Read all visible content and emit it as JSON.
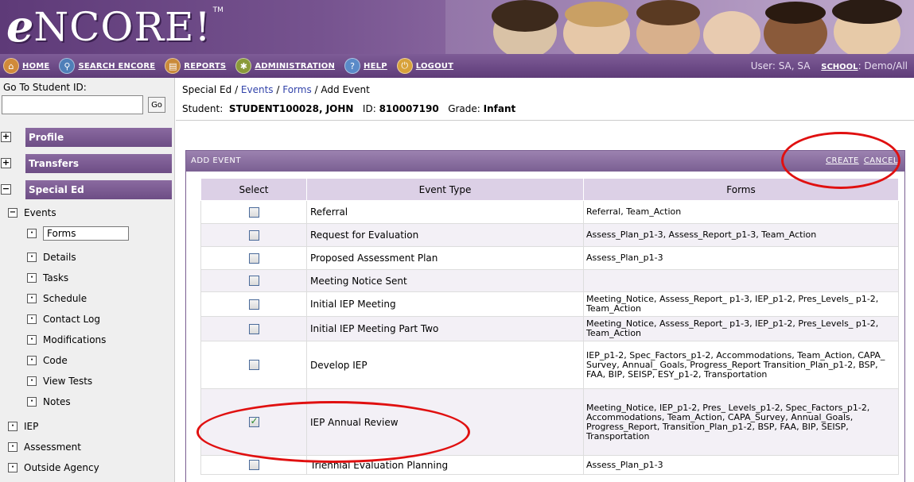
{
  "app": {
    "logo_letter": "e",
    "logo_rest": "NCORE!",
    "logo_tm": "TM"
  },
  "nav": [
    {
      "label": "Home",
      "icon": "home-icon"
    },
    {
      "label": "Search Encore",
      "icon": "search-icon"
    },
    {
      "label": "Reports",
      "icon": "reports-icon"
    },
    {
      "label": "Administration",
      "icon": "administration-icon"
    },
    {
      "label": "Help",
      "icon": "help-icon"
    },
    {
      "label": "Logout",
      "icon": "logout-icon"
    }
  ],
  "user": {
    "text": "User: SA, SA",
    "school_label": "School",
    "school_value": ": Demo/All"
  },
  "sidebar": {
    "goto_label": "Go To Student ID:",
    "goto_value": "",
    "go_button": "Go",
    "sections": [
      {
        "label": "Profile",
        "toggle": "+"
      },
      {
        "label": "Transfers",
        "toggle": "+"
      },
      {
        "label": "Special Ed",
        "toggle": "−"
      }
    ],
    "events_label": "Events",
    "event_children": [
      "Forms",
      "Details",
      "Tasks",
      "Schedule",
      "Contact Log",
      "Modifications",
      "Code",
      "View Tests",
      "Notes"
    ],
    "other_items": [
      "IEP",
      "Assessment",
      "Outside Agency"
    ]
  },
  "breadcrumb": {
    "root": "Special Ed",
    "sep": " / ",
    "events": "Events",
    "forms": "Forms",
    "current": "Add Event"
  },
  "student": {
    "label": "Student:",
    "name": "STUDENT100028, JOHN",
    "id_label": "ID:",
    "id": "810007190",
    "grade_label": "Grade:",
    "grade": "Infant"
  },
  "panel": {
    "title": "Add Event",
    "create": "Create",
    "cancel": "Cancel"
  },
  "table": {
    "headers": [
      "Select",
      "Event Type",
      "Forms"
    ],
    "rows": [
      {
        "checked": false,
        "event": "Referral",
        "forms": "Referral, Team_Action"
      },
      {
        "checked": false,
        "event": "Request for Evaluation",
        "forms": "Assess_Plan_p1-3, Assess_Report_p1-3, Team_Action"
      },
      {
        "checked": false,
        "event": "Proposed Assessment Plan",
        "forms": "Assess_Plan_p1-3"
      },
      {
        "checked": false,
        "event": "Meeting Notice Sent",
        "forms": ""
      },
      {
        "checked": false,
        "event": "Initial IEP Meeting",
        "forms": "Meeting_Notice, Assess_Report_ p1-3, IEP_p1-2, Pres_Levels_ p1-2, Team_Action"
      },
      {
        "checked": false,
        "event": "Initial IEP Meeting Part Two",
        "forms": "Meeting_Notice, Assess_Report_ p1-3, IEP_p1-2, Pres_Levels_ p1-2, Team_Action"
      },
      {
        "checked": false,
        "event": "Develop IEP",
        "forms": "IEP_p1-2, Spec_Factors_p1-2, Accommodations, Team_Action, CAPA_ Survey, Annual_ Goals, Progress_Report Transition_Plan_p1-2, BSP, FAA, BIP, SEISP, ESY_p1-2, Transportation"
      },
      {
        "checked": true,
        "event": "IEP Annual Review",
        "forms": "Meeting_Notice, IEP_p1-2, Pres_ Levels_p1-2, Spec_Factors_p1-2, Accommodations, Team_Action, CAPA_Survey, Annual_Goals, Progress_Report, Transition_Plan_p1-2, BSP, FAA, BIP, SEISP, Transportation"
      },
      {
        "checked": false,
        "event": "Triennial Evaluation Planning",
        "forms": "Assess_Plan_p1-3"
      }
    ]
  },
  "colors": {
    "brand_purple": "#6d4d85",
    "header_light": "#dcd0e6",
    "annotation_red": "#e01010"
  }
}
